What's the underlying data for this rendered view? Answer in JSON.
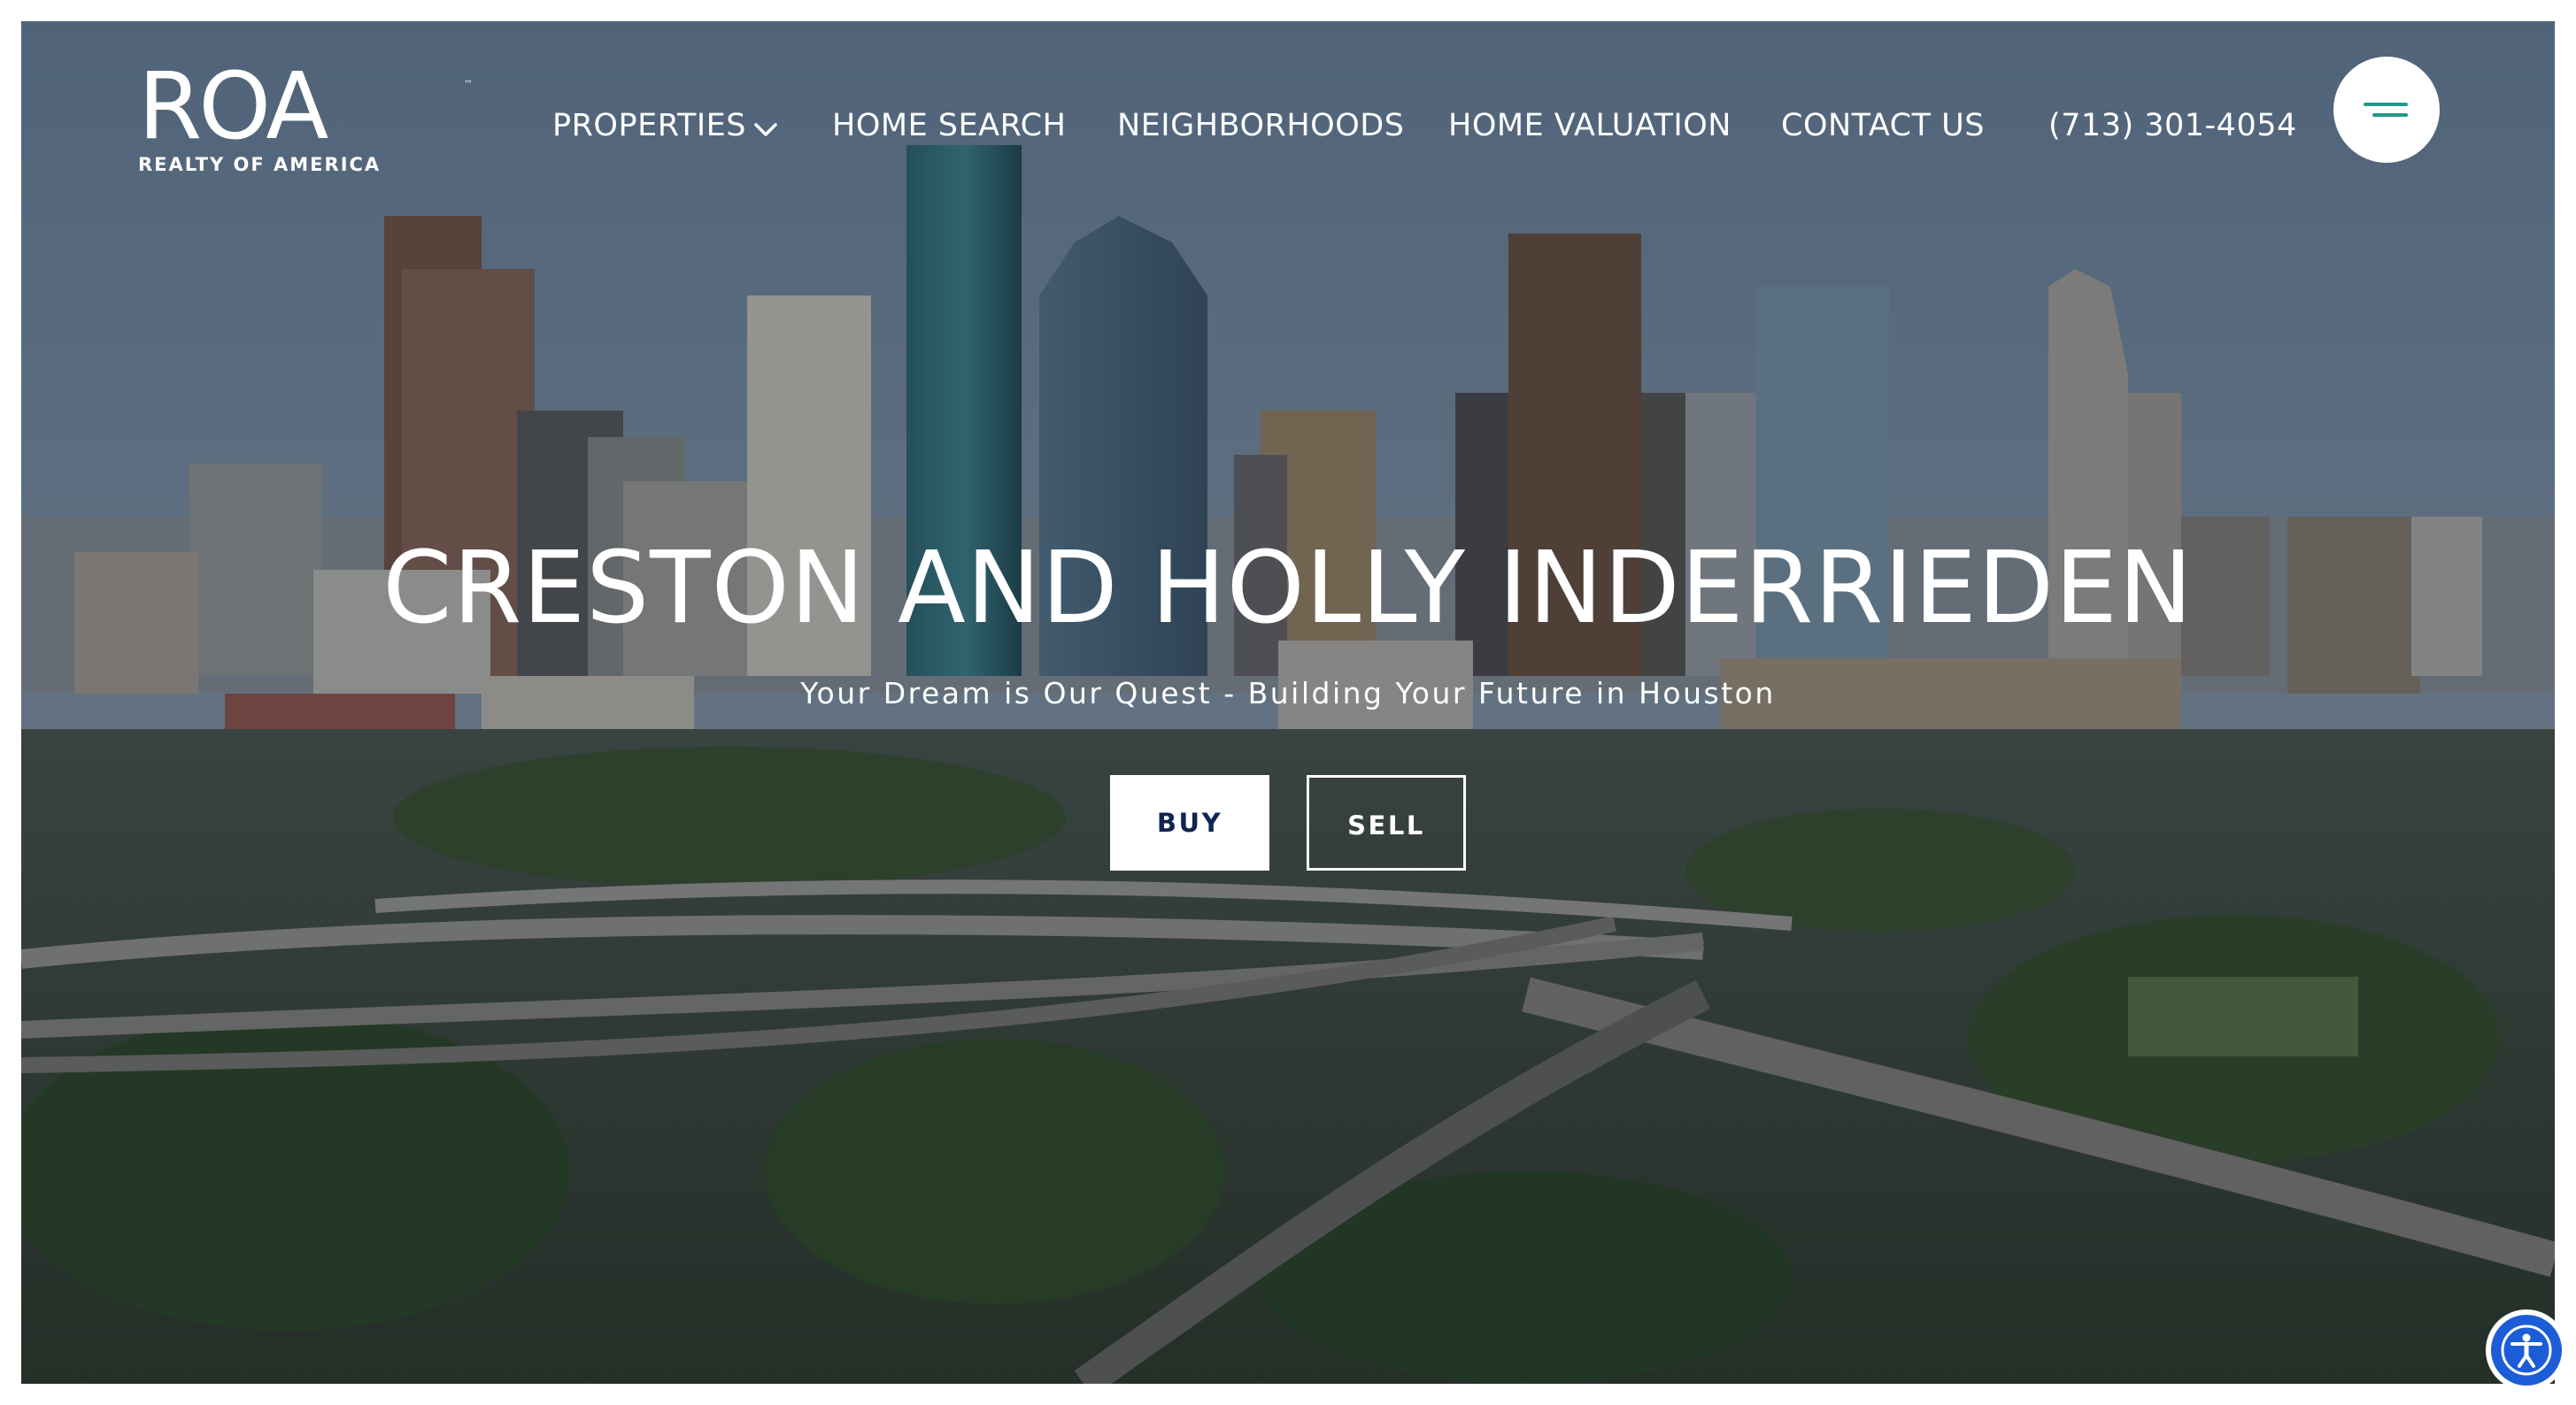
{
  "logo": {
    "mark": "ROA",
    "tm": "™",
    "subtitle": "REALTY OF AMERICA"
  },
  "nav": {
    "items": [
      {
        "label": "PROPERTIES",
        "has_dropdown": true
      },
      {
        "label": "HOME SEARCH"
      },
      {
        "label": "NEIGHBORHOODS"
      },
      {
        "label": "HOME VALUATION"
      },
      {
        "label": "CONTACT US"
      },
      {
        "label": "(713) 301-4054"
      }
    ],
    "menu_icon": "hamburger-menu-icon",
    "dropdown_icon": "chevron-down-icon"
  },
  "hero": {
    "title": "CRESTON AND HOLLY INDERRIEDEN",
    "subtitle": "Your Dream is Our Quest - Building Your Future in Houston",
    "buy_label": "BUY",
    "sell_label": "SELL",
    "background": "houston-skyline-aerial-image"
  },
  "accessibility": {
    "icon": "accessibility-icon"
  },
  "colors": {
    "accent": "#1f9a8c",
    "buy_text": "#0f2650",
    "accessibility": "#1c5cd6"
  }
}
